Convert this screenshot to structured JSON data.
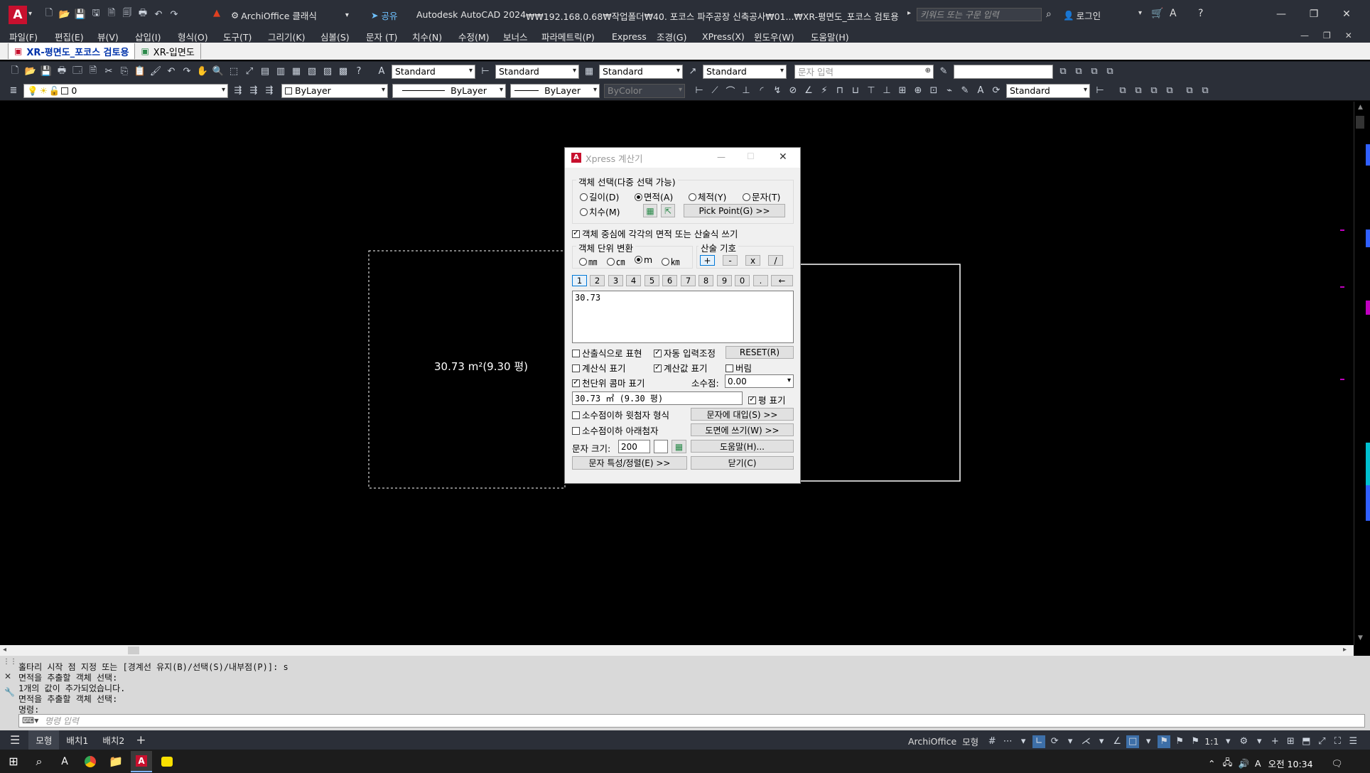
{
  "title_bar": {
    "workspace": "ArchiOffice 클래식",
    "share": "공유",
    "app_title": "Autodesk AutoCAD 2024",
    "file_path": "₩₩192.168.0.68₩작업폴더₩40. 포코스 파주공장 신축공사₩01...₩XR-평면도_포코스 검토용.dwg",
    "search_placeholder": "키워드 또는 구문 입력",
    "login": "로그인"
  },
  "menu": [
    "파일(F)",
    "편집(E)",
    "뷰(V)",
    "삽입(I)",
    "형식(O)",
    "도구(T)",
    "그리기(K)",
    "심볼(S)",
    "문자 (T)",
    "치수(N)",
    "수정(M)",
    "보너스",
    "파라메트릭(P)",
    "Express",
    "조경(G)",
    "XPress(X)",
    "윈도우(W)",
    "도움말(H)"
  ],
  "doc_tabs": [
    {
      "label": "XR-평면도_포코스 검토용",
      "active": true
    },
    {
      "label": "XR-입면도",
      "active": false
    }
  ],
  "toolbar1": {
    "text_style": "Standard",
    "dim_style": "Standard",
    "table_style": "Standard",
    "mleader_style": "Standard",
    "text_input_placeholder": "문자 입력"
  },
  "toolbar2": {
    "layer": "0",
    "color": "ByLayer",
    "linetype": "ByLayer",
    "lineweight": "ByLayer",
    "plotstyle": "ByColor",
    "style": "Standard"
  },
  "canvas": {
    "area_label": "30.73 m²(9.30 평)"
  },
  "dialog": {
    "title": "Xpress 계산기",
    "group_select": "객체 선택(다중 선택 가능)",
    "opt_length": "길이(D)",
    "opt_area": "면적(A)",
    "opt_volume": "체적(Y)",
    "opt_text": "문자(T)",
    "opt_dim": "치수(M)",
    "pick_point": "Pick Point(G) >>",
    "chk_center": "객체 중심에 각각의 면적 또는 산술식 쓰기",
    "group_unit": "객체 단위 변환",
    "unit_mm": "㎜",
    "unit_cm": "㎝",
    "unit_m": "m",
    "unit_km": "㎞",
    "group_op": "산술 기호",
    "ops": [
      "+",
      "-",
      "x",
      "/"
    ],
    "numpad": [
      "1",
      "2",
      "3",
      "4",
      "5",
      "6",
      "7",
      "8",
      "9",
      "0",
      ".",
      "←"
    ],
    "result_text": "30.73",
    "chk_formula_expr": "산출식으로 표현",
    "chk_auto_adjust": "자동 입력조정",
    "reset": "RESET(R)",
    "chk_show_formula": "계산식 표기",
    "chk_show_value": "계산값 표기",
    "chk_round_down": "버림",
    "chk_comma": "천단위 콤마 표기",
    "decimal_label": "소수점:",
    "decimal_value": "0.00",
    "output_value": "30.73 ㎡ (9.30 평)",
    "chk_pyeong": "평 표기",
    "chk_superscript": "소수점이하 윗첨자 형식",
    "chk_subscript": "소수점이하 아래첨자",
    "btn_insert_text": "문자에 대입(S) >>",
    "btn_write_drawing": "도면에 쓰기(W) >>",
    "text_size_label": "문자 크기:",
    "text_size_value": "200",
    "btn_help": "도움말(H)...",
    "btn_text_props": "문자 특성/정렬(E) >>",
    "btn_close": "닫기(C)"
  },
  "command": {
    "lines": [
      "홀타리 시작 점 지정 또는 [경계선 유지(B)/선택(S)/내부점(P)]: s",
      "면적을 추출할 객체 선택:",
      "1개의 값이 추가되었습니다.",
      "면적을 추출할 객체 선택:",
      "명령:"
    ],
    "input_placeholder": "명령 입력"
  },
  "layout_tabs": [
    "모형",
    "배치1",
    "배치2"
  ],
  "status": {
    "archioffice": "ArchiOffice",
    "model": "모형",
    "scale": "1:1"
  },
  "taskbar": {
    "time": "오전 10:34"
  },
  "colors": {
    "app_dark": "#2b2f38",
    "dialog_bg": "#f0f0f0",
    "canvas_bg": "#000000",
    "accent_red": "#d6182b",
    "accent_blue": "#0078d7"
  }
}
